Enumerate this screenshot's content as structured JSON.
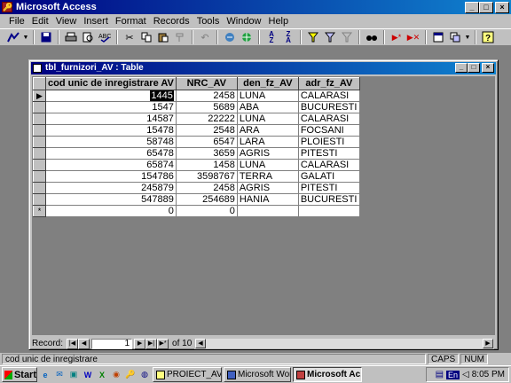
{
  "app": {
    "title": "Microsoft Access",
    "icon": "access-key-icon",
    "controls": [
      "_",
      "□",
      "×"
    ]
  },
  "menu": [
    "File",
    "Edit",
    "View",
    "Insert",
    "Format",
    "Records",
    "Tools",
    "Window",
    "Help"
  ],
  "toolbar": {
    "icons": [
      "design-view-icon",
      "save-icon",
      "print-icon",
      "print-preview-icon",
      "spelling-icon",
      "cut-icon",
      "copy-icon",
      "paste-icon",
      "format-painter-icon",
      "undo-icon",
      "insert-hyperlink-icon",
      "web-toolbar-icon",
      "sort-ascending-icon",
      "sort-descending-icon",
      "filter-by-selection-icon",
      "filter-by-form-icon",
      "apply-filter-icon",
      "find-icon",
      "new-record-icon",
      "delete-record-icon",
      "database-window-icon",
      "new-object-icon",
      "help-icon"
    ]
  },
  "child_window": {
    "title": "tbl_furnizori_AV : Table",
    "controls": [
      "_",
      "□",
      "×"
    ]
  },
  "grid": {
    "headers": [
      "cod unic de inregistrare AV",
      "NRC_AV",
      "den_fz_AV",
      "adr_fz_AV"
    ],
    "rows": [
      [
        "1445",
        "2458",
        "LUNA",
        "CALARASI"
      ],
      [
        "1547",
        "5689",
        "ABA",
        "BUCURESTI"
      ],
      [
        "14587",
        "22222",
        "LUNA",
        "CALARASI"
      ],
      [
        "15478",
        "2548",
        "ARA",
        "FOCSANI"
      ],
      [
        "58748",
        "6547",
        "LARA",
        "PLOIESTI"
      ],
      [
        "65478",
        "3659",
        "AGRIS",
        "PITESTI"
      ],
      [
        "65874",
        "1458",
        "LUNA",
        "CALARASI"
      ],
      [
        "154786",
        "3598767",
        "TERRA",
        "GALATI"
      ],
      [
        "245879",
        "2458",
        "AGRIS",
        "PITESTI"
      ],
      [
        "547889",
        "254689",
        "HANIA",
        "BUCURESTI"
      ]
    ],
    "new_row": [
      "0",
      "0",
      "",
      ""
    ],
    "current_row_marker": "▶",
    "new_row_marker": "*"
  },
  "record_nav": {
    "label": "Record:",
    "current": "1",
    "of_label": "of 10"
  },
  "status": {
    "text": "cod unic de inregistrare",
    "caps": "CAPS",
    "num": "NUM"
  },
  "taskbar": {
    "start": "Start",
    "buttons": [
      "PROIECT_AV",
      "Microsoft Word ...",
      "Microsoft Ac..."
    ],
    "lang": "En",
    "clock": "8:05 PM"
  }
}
